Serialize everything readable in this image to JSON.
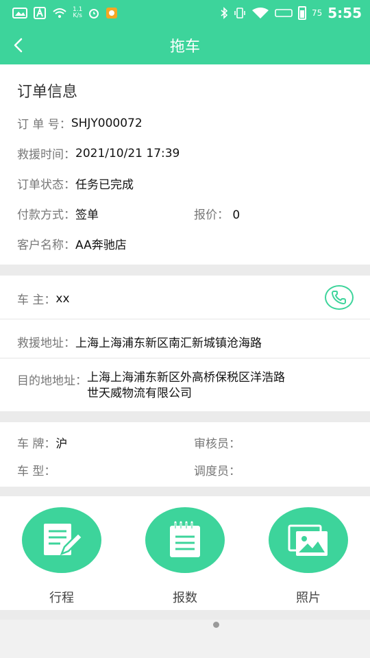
{
  "status_bar": {
    "speed": "1.1",
    "speed_unit": "K/s",
    "battery": "75",
    "time": "5:55"
  },
  "header": {
    "title": "拖车"
  },
  "order": {
    "section_title": "订单信息",
    "order_no_label": "订 单 号：",
    "order_no": "SHJY000072",
    "rescue_time_label": "救援时间：",
    "rescue_time": "2021/10/21 17:39",
    "status_label": "订单状态：",
    "status": "任务已完成",
    "payment_label": "付款方式：",
    "payment": "签单",
    "quote_label": "报价：",
    "quote": "0",
    "customer_label": "客户名称：",
    "customer": "AA奔驰店"
  },
  "contact": {
    "owner_label": "车 主：",
    "owner": "xx",
    "rescue_address_label": "救援地址：",
    "rescue_address": "上海上海浦东新区南汇新城镇沧海路",
    "destination_label": "目的地地址：",
    "destination_line1": "上海上海浦东新区外高桥保税区洋浩路",
    "destination_line2": "世天威物流有限公司"
  },
  "vehicle": {
    "plate_label": "车 牌：",
    "plate": "沪",
    "auditor_label": "审核员：",
    "auditor": "",
    "model_label": "车 型：",
    "model": "",
    "dispatcher_label": "调度员：",
    "dispatcher": ""
  },
  "actions": [
    {
      "label": "行程",
      "icon": "edit-note-icon"
    },
    {
      "label": "报数",
      "icon": "notepad-icon"
    },
    {
      "label": "照片",
      "icon": "photos-icon"
    }
  ],
  "colors": {
    "accent": "#3dd49b",
    "background": "#ebebeb"
  }
}
